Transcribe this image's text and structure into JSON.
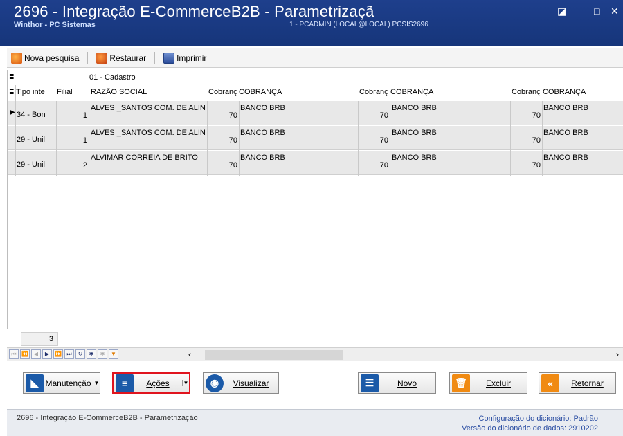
{
  "window": {
    "title": "2696 - Integração E-CommerceB2B - Parametrizaçã",
    "company": "Winthor - PC Sistemas",
    "session": "1 - PCADMIN (LOCAL@LOCAL)   PCSIS2696"
  },
  "toolbar": {
    "new_search": "Nova pesquisa",
    "restore": "Restaurar",
    "print": "Imprimir"
  },
  "grid": {
    "band_label": "01 - Cadastro",
    "headers": {
      "tipo": "Tipo inte",
      "filial": "Filial",
      "razao": "RAZÃO SOCIAL",
      "cobranc1": "Cobranç",
      "cobranca1": "COBRANÇA",
      "cobranc2": "Cobranç",
      "cobranca2": "COBRANÇA",
      "cobranc3": "Cobranç",
      "cobranca3": "COBRANÇA"
    },
    "rows": [
      {
        "tipo": "34 - Bon",
        "filial": "1",
        "razao": "ALVES _SANTOS COM. DE ALIN",
        "c1": "70",
        "n1": "BANCO BRB",
        "c2": "70",
        "n2": "BANCO BRB",
        "c3": "70",
        "n3": "BANCO BRB"
      },
      {
        "tipo": "29 - Unil",
        "filial": "1",
        "razao": "ALVES _SANTOS COM. DE ALIN",
        "c1": "70",
        "n1": "BANCO BRB",
        "c2": "70",
        "n2": "BANCO BRB",
        "c3": "70",
        "n3": "BANCO BRB"
      },
      {
        "tipo": "29 - Unil",
        "filial": "2",
        "razao": "ALVIMAR CORREIA DE BRITO",
        "c1": "70",
        "n1": "BANCO BRB",
        "c2": "70",
        "n2": "BANCO BRB",
        "c3": "70",
        "n3": "BANCO BRB"
      }
    ],
    "record_count": "3"
  },
  "actions": {
    "maintenance": "Manutenção",
    "actions": "Ações",
    "view": "Visualizar",
    "new": "Novo",
    "delete": "Excluir",
    "back": "Retornar"
  },
  "status": {
    "left": "2696 - Integração E-CommerceB2B - Parametrização",
    "dict_config": "Configuração do dicionário: Padrão",
    "dict_version": "Versão do dicionário de dados: 2910202"
  },
  "colors": {
    "titlebar": "#1e3f8c",
    "highlight_border": "#e0141e",
    "row_background": "#e8e8e8",
    "status_text": "#2b4ea3"
  }
}
